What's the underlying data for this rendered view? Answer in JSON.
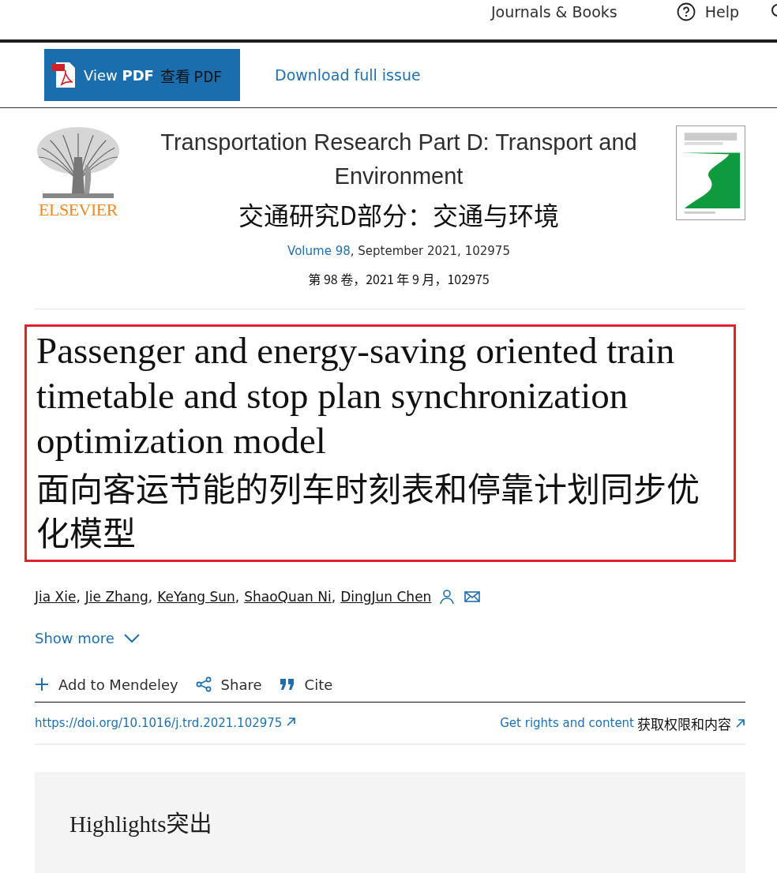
{
  "top_nav": {
    "links": [
      {
        "label": "Journals & Books",
        "kind": "text"
      },
      {
        "label": "Help",
        "kind": "help"
      }
    ]
  },
  "toolbar": {
    "pdf_button": {
      "label": "View **PDF**",
      "translation": "查看 PDF"
    },
    "download_link": "Download full issue"
  },
  "journal": {
    "publisher": "ELSEVIER",
    "title": "Transportation Research Part D: Transport and Environment",
    "title_translation": "交通研究D部分：交通与环境",
    "volume_link": "Volume 98",
    "issue_info": ", September 2021, 102975",
    "issue_translation": "第 98 卷，2021 年 9 月，102975"
  },
  "article": {
    "highlighted": true,
    "title": "Passenger and energy-saving oriented train timetable and stop plan synchronization optimization model",
    "title_translation": "面向客运节能的列车时刻表和停靠计划同步优化模型",
    "authors": [
      {
        "name": "Jia Xie",
        "separator": ","
      },
      {
        "name": "Jie Zhang",
        "separator": ","
      },
      {
        "name": "KeYang Sun",
        "separator": ","
      },
      {
        "name": "ShaoQuan Ni",
        "separator": ","
      },
      {
        "name": "DingJun Chen"
      }
    ],
    "show_more": "Show more",
    "actions": [
      {
        "label": "Add to Mendeley",
        "kind": "plus"
      },
      {
        "label": "Share",
        "kind": "share"
      },
      {
        "label": "Cite",
        "kind": "quote"
      }
    ],
    "doi": "https://doi.org/10.1016/j.trd.2021.102975",
    "rights_link": "Get rights and content",
    "rights_translation": "获取权限和内容"
  },
  "highlights": {
    "heading": "Highlights",
    "heading_translation": "突出"
  }
}
